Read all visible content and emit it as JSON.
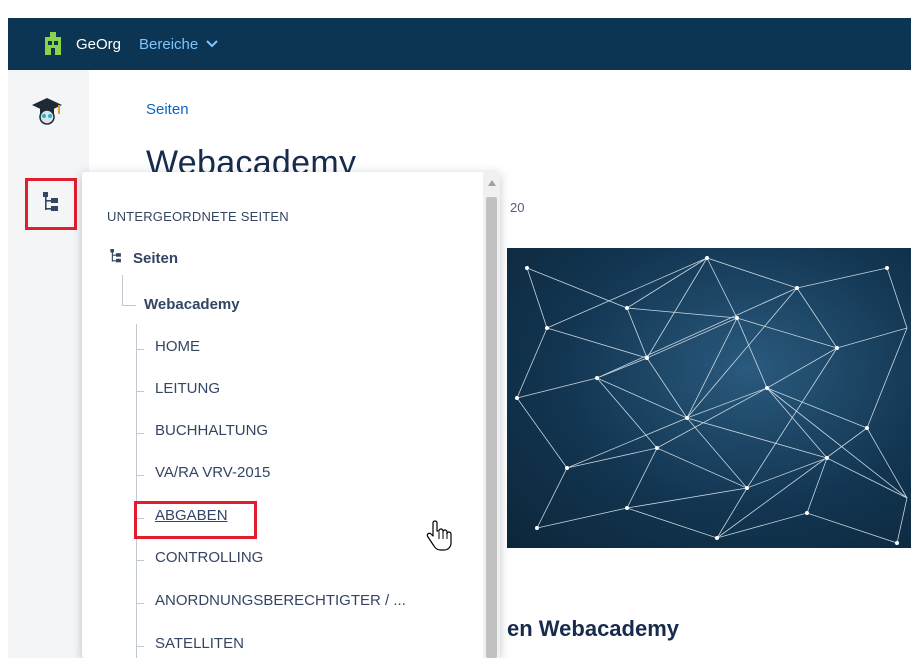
{
  "topbar": {
    "logo_icon": "building-icon",
    "app_title": "GeOrg",
    "menu_label": "Bereiche",
    "menu_chevron": "chevron-down-icon",
    "bg_color": "#0b3553"
  },
  "sidebar": {
    "items": [
      {
        "icon": "graduation-cap-icon"
      },
      {
        "icon": "page-tree-icon",
        "highlighted": true
      }
    ]
  },
  "main": {
    "breadcrumb": "Seiten",
    "page_title": "Webacademy",
    "meta_fragment": "20",
    "section_heading": "en Webacademy"
  },
  "page_tree_popup": {
    "heading": "UNTERGEORDNETE SEITEN",
    "root": {
      "icon": "page-tree-icon",
      "label": "Seiten"
    },
    "parent": {
      "label": "Webacademy"
    },
    "children": [
      {
        "label": "HOME"
      },
      {
        "label": "LEITUNG"
      },
      {
        "label": "BUCHHALTUNG"
      },
      {
        "label": "VA/RA VRV-2015"
      },
      {
        "label": "ABGABEN",
        "hovered": true,
        "highlighted": true
      },
      {
        "label": "CONTROLLING"
      },
      {
        "label": "ANORDNUNGSBERECHTIGTER / ..."
      },
      {
        "label": "SATELLITEN"
      }
    ]
  },
  "colors": {
    "accent_link": "#0b66c3",
    "highlight_box": "#e11d2e"
  }
}
